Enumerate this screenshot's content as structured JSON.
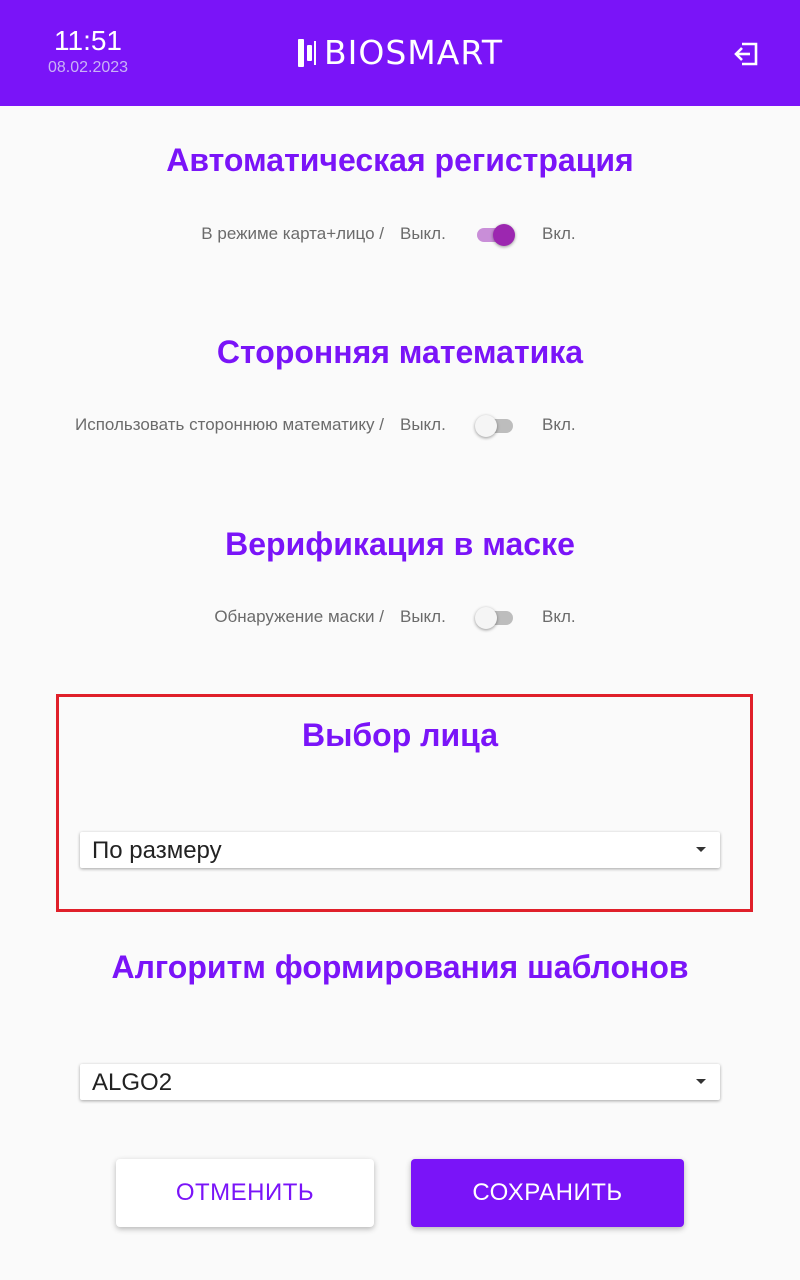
{
  "header": {
    "time": "11:51",
    "date": "08.02.2023",
    "logo_text": "BIOSMART",
    "icons": {
      "logo": "biosmart-logo-mark",
      "exit": "exit-icon"
    }
  },
  "auto_registration": {
    "title": "Автоматическая регистрация",
    "label": "В режиме карта+лицо /",
    "off": "Выкл.",
    "on": "Вкл.",
    "enabled": true
  },
  "third_party_math": {
    "title": "Сторонняя математика",
    "label": "Использовать стороннюю математику /",
    "off": "Выкл.",
    "on": "Вкл.",
    "enabled": false
  },
  "mask_verification": {
    "title": "Верификация в маске",
    "label": "Обнаружение маски /",
    "off": "Выкл.",
    "on": "Вкл.",
    "enabled": false
  },
  "face_selection": {
    "title": "Выбор лица",
    "selected": "По размеру"
  },
  "template_algorithm": {
    "title": "Алгоритм формирования шаблонов",
    "selected": "ALGO2"
  },
  "buttons": {
    "cancel": "ОТМЕНИТЬ",
    "save": "СОХРАНИТЬ"
  },
  "colors": {
    "accent": "#7a14f8",
    "switch_on": "#9c27b0",
    "highlight": "#e0202a"
  }
}
